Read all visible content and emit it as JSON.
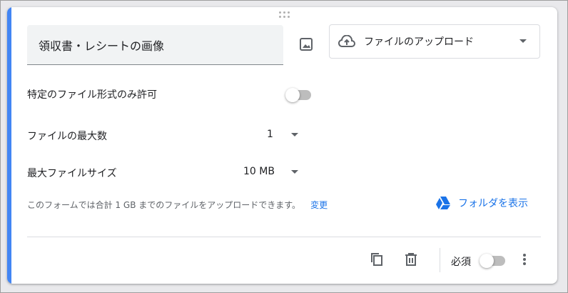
{
  "question": {
    "title": "領収書・レシートの画像",
    "type_label": "ファイルのアップロード"
  },
  "settings": {
    "specific_types_label": "特定のファイル形式のみ許可",
    "specific_types_on": false,
    "max_files_label": "ファイルの最大数",
    "max_files_value": "1",
    "max_size_label": "最大ファイルサイズ",
    "max_size_value": "10 MB"
  },
  "note": {
    "text": "このフォームでは合計 1 GB までのファイルをアップロードできます。",
    "change_link": "変更"
  },
  "folder_link": "フォルダを表示",
  "footer": {
    "required_label": "必須",
    "required_on": false
  },
  "colors": {
    "accent": "#4285f4",
    "link": "#1a73e8",
    "drive_blue": "#1a73e8"
  },
  "icons": [
    "drag-handle-icon",
    "image-icon",
    "cloud-upload-icon",
    "dropdown-caret-icon",
    "drive-icon",
    "copy-icon",
    "trash-icon",
    "more-vert-icon"
  ]
}
